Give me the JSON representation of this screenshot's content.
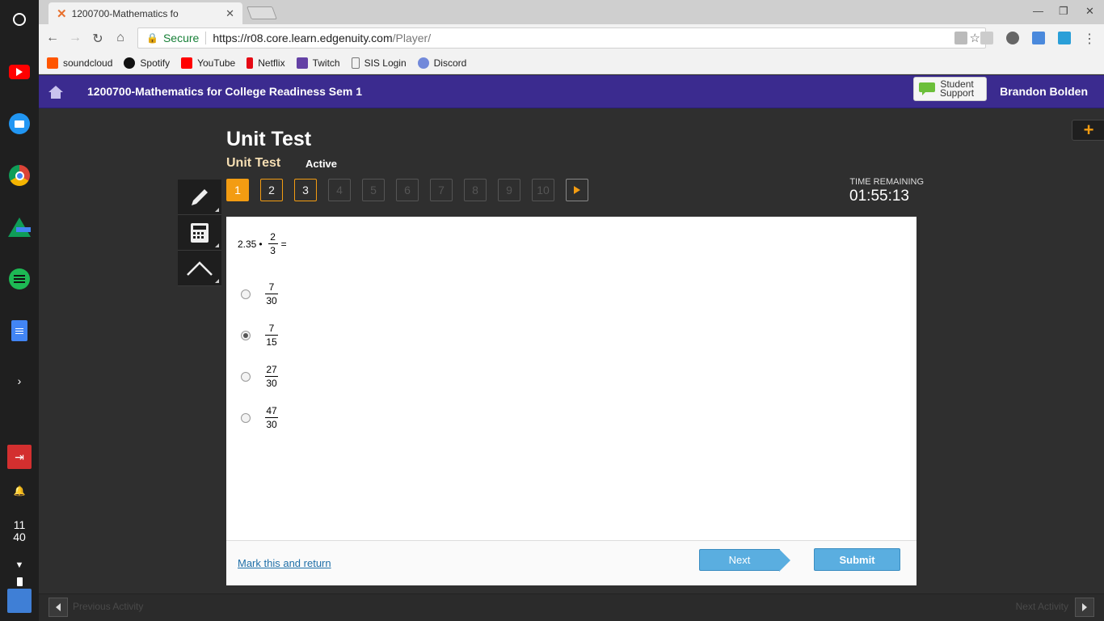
{
  "browser": {
    "tab_title": "1200700-Mathematics fo",
    "secure_label": "Secure",
    "url_scheme_host": "https://r08.core.learn.edgenuity.com",
    "url_path": "/Player/"
  },
  "bookmarks": [
    {
      "label": "soundcloud",
      "color": "#ff5500"
    },
    {
      "label": "Spotify",
      "color": "#1db954"
    },
    {
      "label": "YouTube",
      "color": "#ff0000"
    },
    {
      "label": "Netflix",
      "color": "#e50914"
    },
    {
      "label": "Twitch",
      "color": "#6441a5"
    },
    {
      "label": "SIS Login",
      "color": "#777777"
    },
    {
      "label": "Discord",
      "color": "#7289da"
    }
  ],
  "shelf": {
    "time_hour": "11",
    "time_min": "40"
  },
  "app": {
    "course_title": "1200700-Mathematics for College Readiness Sem 1",
    "support_label_1": "Student",
    "support_label_2": "Support",
    "user_name": "Brandon Bolden",
    "accent": "#3b2b8f"
  },
  "test": {
    "title": "Unit Test",
    "subtitle": "Unit Test",
    "status": "Active",
    "questions": [
      "1",
      "2",
      "3",
      "4",
      "5",
      "6",
      "7",
      "8",
      "9",
      "10"
    ],
    "timer_label": "TIME REMAINING",
    "timer": "01:55:13"
  },
  "question": {
    "lhs_number": "2.35",
    "op": "•",
    "frac_num": "2",
    "frac_den": "3",
    "eq": "=",
    "choices": [
      {
        "num": "7",
        "den": "30",
        "selected": false
      },
      {
        "num": "7",
        "den": "15",
        "selected": true
      },
      {
        "num": "27",
        "den": "30",
        "selected": false
      },
      {
        "num": "47",
        "den": "30",
        "selected": false
      }
    ]
  },
  "footer": {
    "mark_return": "Mark this and return",
    "next": "Next",
    "submit": "Submit"
  },
  "bottom": {
    "prev_activity": "Previous Activity",
    "next_activity": "Next Activity"
  }
}
